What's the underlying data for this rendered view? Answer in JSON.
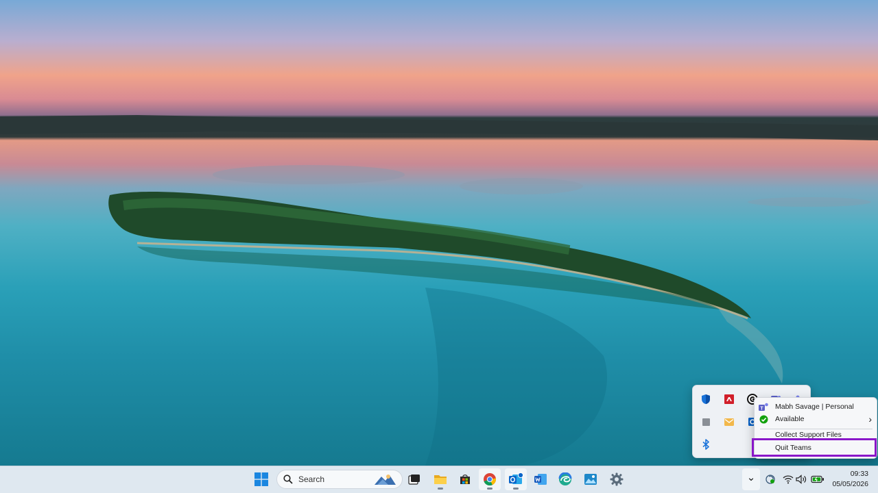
{
  "context_menu": {
    "account_label": "Mabh Savage | Personal",
    "status_label": "Available",
    "status_chevron": "›",
    "support_label": "Collect Support Files",
    "quit_label": "Quit Teams"
  },
  "taskbar": {
    "search_label": "Search",
    "time": "09:33",
    "date": "05/05/2026",
    "expand_chevron": "⌄"
  },
  "icons": {
    "windows": "windows-logo-icon",
    "search": "search-icon",
    "task_view": "task-view-icon",
    "explorer": "file-explorer-icon",
    "store": "microsoft-store-icon",
    "chrome": "chrome-icon",
    "outlook": "outlook-icon",
    "word": "word-icon",
    "edge": "edge-icon",
    "photos": "photos-icon",
    "settings": "settings-gear-icon"
  },
  "colors": {
    "highlight": "#8a16c9",
    "available": "#13a10e",
    "teams": "#5b5fc7"
  }
}
